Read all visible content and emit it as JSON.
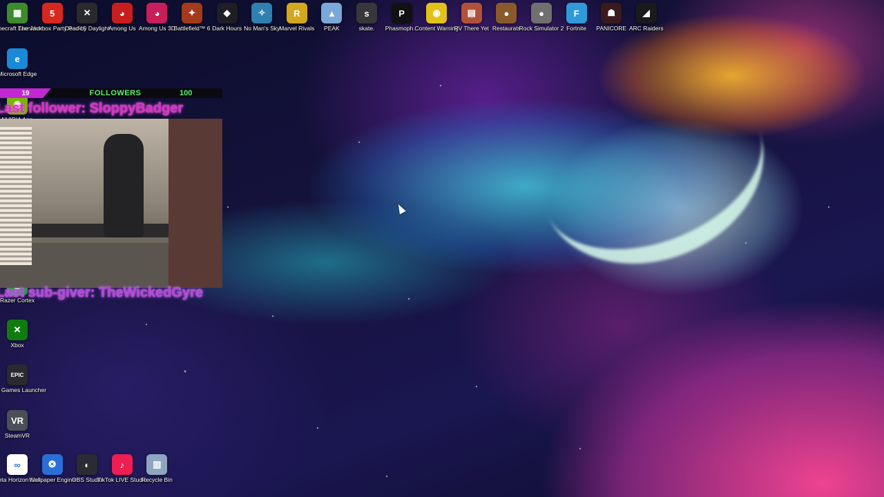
{
  "desktop": {
    "top_row": [
      {
        "label": "Minecraft Launcher",
        "icon": "minecraft-icon",
        "glyph": "▦",
        "color": "#3c8b2c"
      },
      {
        "label": "The Jackbox Party Pack 5",
        "icon": "jackbox-icon",
        "glyph": "5",
        "color": "#d6281e"
      },
      {
        "label": "Dead by Daylight",
        "icon": "dead-by-daylight-icon",
        "glyph": "✕",
        "color": "#2a2a2e"
      },
      {
        "label": "Among Us",
        "icon": "among-us-icon",
        "glyph": "◕",
        "color": "#c81e1e"
      },
      {
        "label": "Among Us 3D",
        "icon": "among-us-3d-icon",
        "glyph": "◕",
        "color": "#c81e5a"
      },
      {
        "label": "Battlefield™ 6",
        "icon": "battlefield-icon",
        "glyph": "✦",
        "color": "#a43a1c"
      },
      {
        "label": "Dark Hours",
        "icon": "dark-hours-icon",
        "glyph": "◆",
        "color": "#1e1e24"
      },
      {
        "label": "No Man's Sky",
        "icon": "no-mans-sky-icon",
        "glyph": "✧",
        "color": "#2f7fb0"
      },
      {
        "label": "Marvel Rivals",
        "icon": "marvel-rivals-icon",
        "glyph": "R",
        "color": "#d4a81e"
      },
      {
        "label": "PEAK",
        "icon": "peak-icon",
        "glyph": "▲",
        "color": "#7aa8d8"
      },
      {
        "label": "skate.",
        "icon": "skate-icon",
        "glyph": "s",
        "color": "#38383c"
      },
      {
        "label": "Phasmoph...",
        "icon": "phasmophobia-icon",
        "glyph": "P",
        "color": "#111114"
      },
      {
        "label": "Content Warning",
        "icon": "content-warning-icon",
        "glyph": "◉",
        "color": "#e2c21a"
      },
      {
        "label": "RV There Yet",
        "icon": "rv-there-yet-icon",
        "glyph": "▤",
        "color": "#b0523a"
      },
      {
        "label": "Restaurats",
        "icon": "restaurats-icon",
        "glyph": "●",
        "color": "#8a5a2a"
      },
      {
        "label": "Rock Simulator 2",
        "icon": "rock-simulator-icon",
        "glyph": "●",
        "color": "#707070"
      },
      {
        "label": "Fortnite",
        "icon": "fortnite-icon",
        "glyph": "F",
        "color": "#2f9ad8"
      },
      {
        "label": "PANICORE",
        "icon": "panicore-icon",
        "glyph": "☗",
        "color": "#3a1a1e"
      },
      {
        "label": "ARC Raiders",
        "icon": "arc-raiders-icon",
        "glyph": "◢",
        "color": "#1a1a1e"
      }
    ],
    "left_column": [
      {
        "label": "Microsoft Edge",
        "icon": "microsoft-edge-icon",
        "glyph": "e",
        "color": "#1a8ad8"
      },
      {
        "label": "NVIDIA App",
        "icon": "nvidia-app-icon",
        "glyph": "◉",
        "color": "#76b900"
      },
      {
        "label": "Razer Cortex",
        "icon": "razer-cortex-icon",
        "glyph": "◎",
        "color": "#1f9e3c"
      },
      {
        "label": "Xbox",
        "icon": "xbox-icon",
        "glyph": "✕",
        "color": "#107c10"
      },
      {
        "label": "Epic Games Launcher",
        "icon": "epic-games-icon",
        "glyph": "EPIC",
        "color": "#2a2a2e"
      },
      {
        "label": "SteamVR",
        "icon": "steamvr-icon",
        "glyph": "VR",
        "color": "#4a4f58"
      }
    ],
    "bottom_row": [
      {
        "label": "Meta Horizon Link",
        "icon": "meta-horizon-icon",
        "glyph": "∞",
        "color": "#ffffff"
      },
      {
        "label": "Wallpaper Engine",
        "icon": "wallpaper-engine-icon",
        "glyph": "❂",
        "color": "#2a6fd8"
      },
      {
        "label": "OBS Studio",
        "icon": "obs-studio-icon",
        "glyph": "◐",
        "color": "#2b2b33"
      },
      {
        "label": "TikTok LIVE Studio",
        "icon": "tiktok-live-icon",
        "glyph": "♪",
        "color": "#ee1d52"
      },
      {
        "label": "Recycle Bin",
        "icon": "recycle-bin-icon",
        "glyph": "▥",
        "color": "#8ea6c0"
      }
    ]
  },
  "stream_overlay": {
    "followers_current": "19",
    "followers_label": "FOLLOWERS",
    "followers_goal": "100",
    "last_follower_text": "Last follower: SloppyBadger",
    "last_sub_text": "Last sub-giver: TheWickedGyre",
    "accent_color": "#c426d4",
    "goal_text_color": "#5ef06a"
  }
}
